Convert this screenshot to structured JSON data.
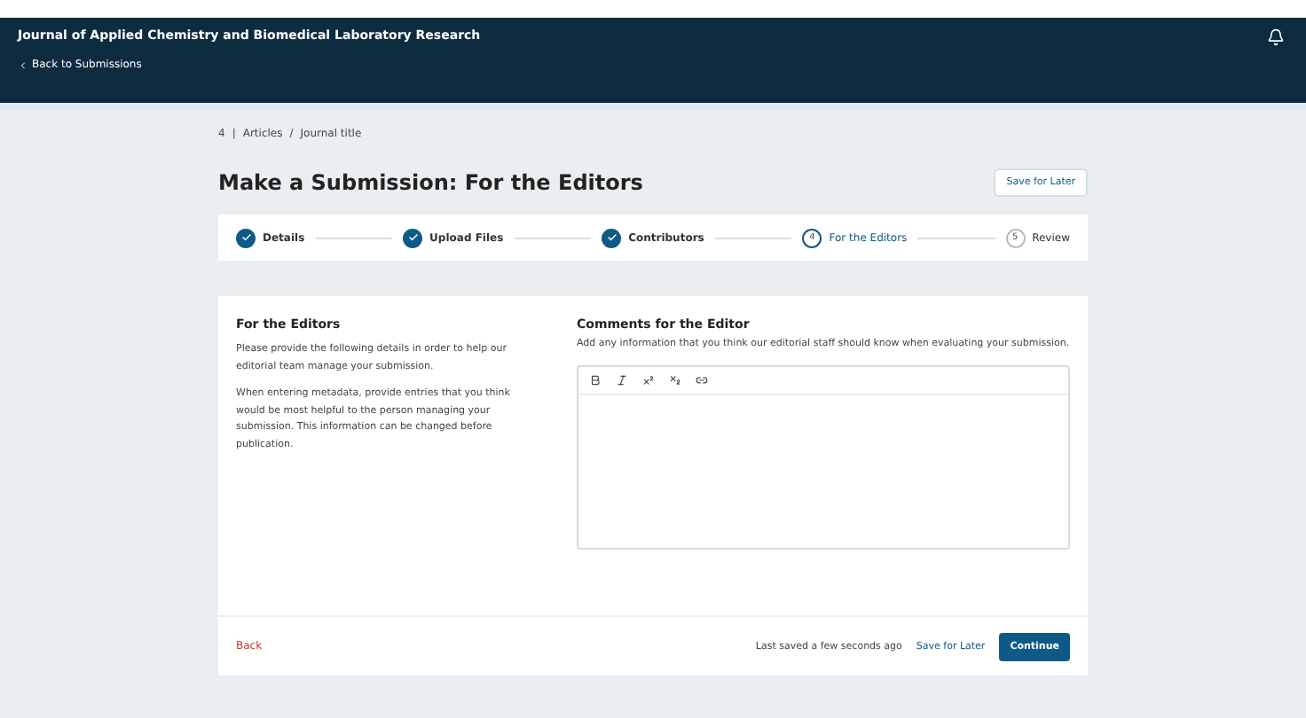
{
  "header": {
    "title": "Journal of Applied Chemistry and Biomedical Laboratory Research",
    "back_link": "Back to Submissions"
  },
  "breadcrumb": {
    "number": "4",
    "separator_1": "|",
    "section": "Articles",
    "separator_2": "/",
    "title": "Journal title"
  },
  "page_title": "Make a Submission: For the Editors",
  "save_later_top": "Save for Later",
  "steps": [
    {
      "label": "Details",
      "completed": true,
      "selected": false
    },
    {
      "label": "Upload Files",
      "completed": true,
      "selected": false
    },
    {
      "label": "Contributors",
      "completed": true,
      "selected": false
    },
    {
      "number": "4",
      "label": "For the Editors",
      "completed": false,
      "selected": true
    },
    {
      "number": "5",
      "label": "Review",
      "completed": false,
      "selected": false
    }
  ],
  "section": {
    "heading": "For the Editors",
    "paragraphs": [
      "Please provide the following details in order to help our editorial team manage your submission.",
      "When entering metadata, provide entries that you think would be most helpful to the person managing your submission. This information can be changed before publication."
    ]
  },
  "comments": {
    "label": "Comments for the Editor",
    "description": "Add any information that you think our editorial staff should know when evaluating your submission."
  },
  "footer": {
    "back": "Back",
    "status": "Last saved a few seconds ago",
    "save_later": "Save for Later",
    "continue": "Continue"
  }
}
